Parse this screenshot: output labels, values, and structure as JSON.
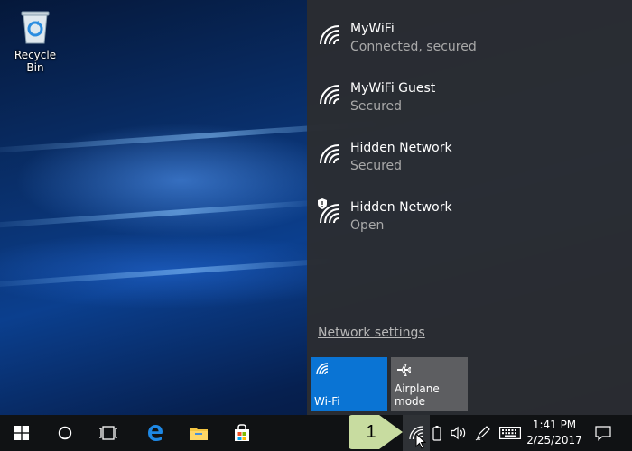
{
  "desktop": {
    "recycle_bin_label": "Recycle Bin"
  },
  "flyout": {
    "networks": [
      {
        "name": "MyWiFi",
        "status": "Connected, secured",
        "icon": "wifi-signal-icon"
      },
      {
        "name": "MyWiFi Guest",
        "status": "Secured",
        "icon": "wifi-signal-icon"
      },
      {
        "name": "Hidden Network",
        "status": "Secured",
        "icon": "wifi-signal-icon"
      },
      {
        "name": "Hidden Network",
        "status": "Open",
        "icon": "wifi-signal-shield-icon"
      }
    ],
    "network_settings_label": "Network settings",
    "tiles": {
      "wifi_label": "Wi-Fi",
      "airplane_label": "Airplane mode"
    }
  },
  "taskbar": {
    "time": "1:41 PM",
    "date": "2/25/2017"
  },
  "callout": {
    "number": "1"
  },
  "colors": {
    "accent": "#0a74d4",
    "flyout_bg": "#2b2d31",
    "taskbar_bg": "#101214",
    "callout_bg": "#c8dca0"
  }
}
